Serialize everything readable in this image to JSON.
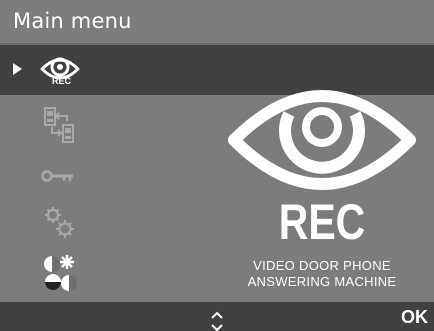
{
  "header": {
    "title": "Main menu"
  },
  "menu": {
    "items": [
      {
        "icon": "eye-rec-icon",
        "label": "REC",
        "selected": true
      },
      {
        "icon": "intercom-transfer-icon",
        "selected": false
      },
      {
        "icon": "key-icon",
        "selected": false
      },
      {
        "icon": "gears-icon",
        "selected": false
      },
      {
        "icon": "display-settings-icon",
        "selected": false
      }
    ]
  },
  "preview": {
    "icon": "eye-icon",
    "title": "REC",
    "line1": "VIDEO DOOR PHONE",
    "line2": "ANSWERING MACHINE"
  },
  "footer": {
    "ok_label": "OK"
  },
  "colors": {
    "background": "#7c7c7c",
    "selected_row": "#414141",
    "footer": "#414141",
    "active_fg": "#ffffff",
    "inactive_fg": "#a8a8a8"
  }
}
